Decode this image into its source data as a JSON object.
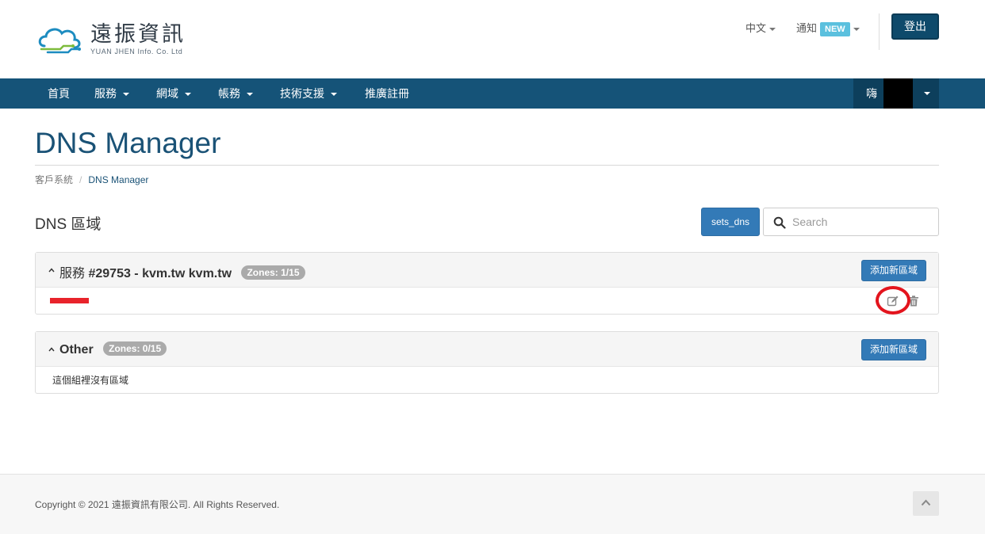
{
  "brand": {
    "name": "遠振資訊",
    "sub": "YUAN JHEN Info. Co. Ltd"
  },
  "topbar": {
    "language": "中文",
    "notifications": "通知",
    "new_badge": "NEW",
    "logout": "登出"
  },
  "nav": {
    "items": [
      {
        "label": "首頁"
      },
      {
        "label": "服務"
      },
      {
        "label": "網域"
      },
      {
        "label": "帳務"
      },
      {
        "label": "技術支援"
      },
      {
        "label": "推廣註冊"
      }
    ],
    "greeting": "嗨"
  },
  "page": {
    "title": "DNS Manager",
    "breadcrumb": [
      {
        "label": "客戶系統"
      },
      {
        "label": "DNS Manager"
      }
    ],
    "section_title": "DNS 區域"
  },
  "toolbar": {
    "sets_dns": "sets_dns",
    "search_placeholder": "Search"
  },
  "groups": [
    {
      "prefix": "服務",
      "name": "#29753 - kvm.tw kvm.tw",
      "zones": "Zones: 1/15",
      "add_label": "添加新區域"
    },
    {
      "prefix": "",
      "name": "Other",
      "zones": "Zones: 0/15",
      "add_label": "添加新區域",
      "empty_text": "這個組裡沒有區域"
    }
  ],
  "footer": {
    "copyright": "Copyright © 2021 遠振資訊有限公司. All Rights Reserved."
  },
  "colors": {
    "navbar": "#155378",
    "primary": "#337ab7",
    "title": "#1a5276",
    "highlight": "#e3141d"
  }
}
